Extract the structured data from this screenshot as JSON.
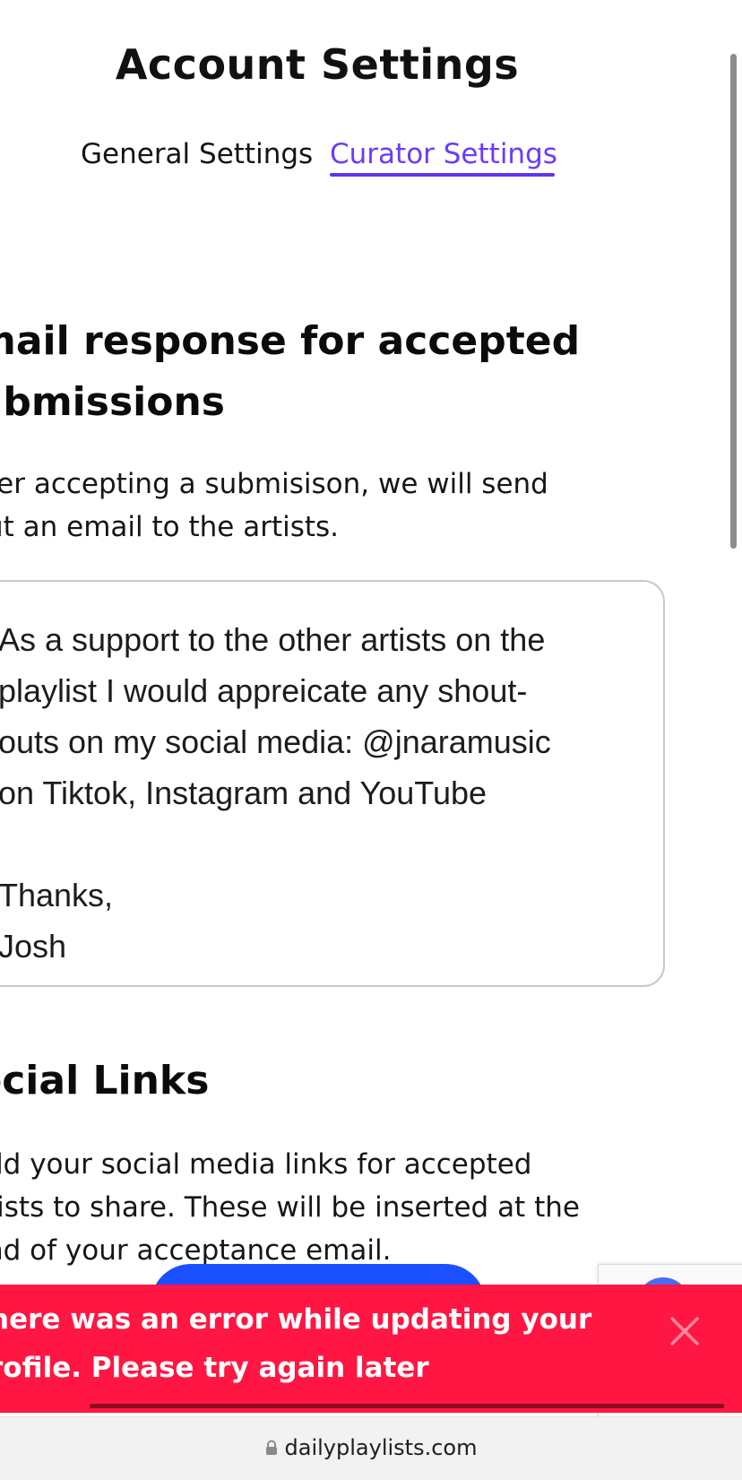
{
  "header": {
    "title": "Account Settings"
  },
  "tabs": {
    "general": "General Settings",
    "curator": "Curator Settings",
    "active": "curator"
  },
  "email_section": {
    "heading_line1": "mail response for accepted",
    "heading_line2": "ubmissions",
    "desc_line1": "ter accepting a submisison, we will send",
    "desc_line2": "ut an email to the artists.",
    "message": "As a support to the other artists on the\nplaylist I would appreicate any shout-\nouts on my social media: @jnaramusic\non Tiktok, Instagram and YouTube\n\nThanks,\nJosh"
  },
  "social_section": {
    "heading": "ocial Links",
    "desc_line1": "dd your social media links for accepted",
    "desc_line2": "tists to share. These will be inserted at the",
    "desc_line3": "nd of your acceptance email."
  },
  "error_toast": {
    "message": "here was an error while updating your\nrofile. Please try again later",
    "close_icon": "close-icon",
    "background": "#ff1642"
  },
  "browser": {
    "url": "dailyplaylists.com",
    "secure_icon": "lock-icon"
  },
  "colors": {
    "accent": "#6a3bff",
    "primary_button": "#1a50ff",
    "error": "#ff1642"
  }
}
